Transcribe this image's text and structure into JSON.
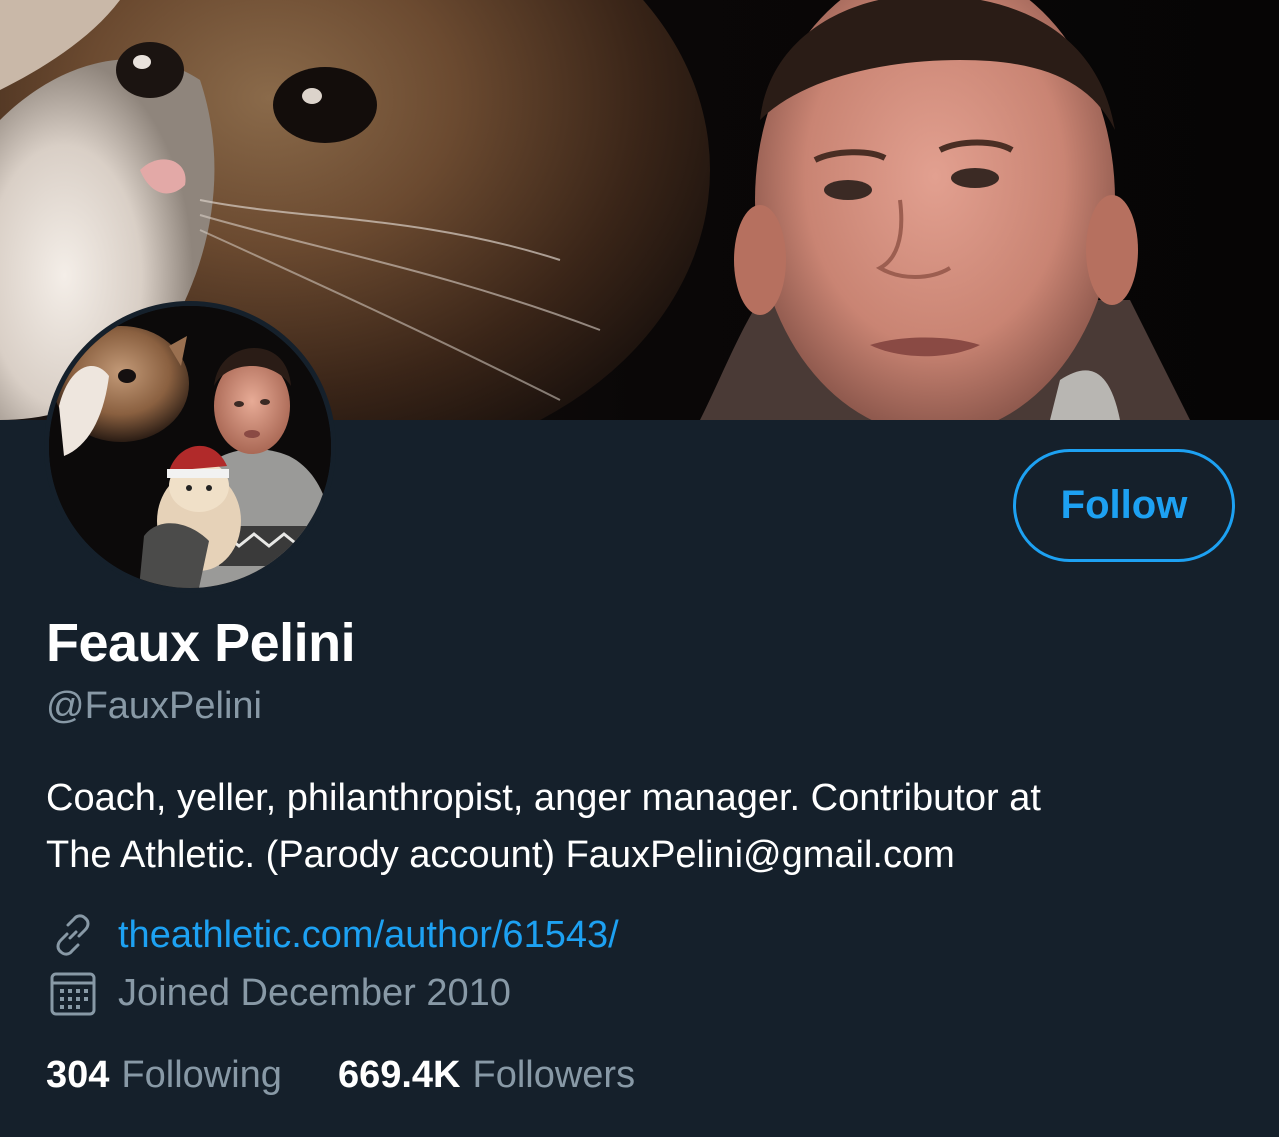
{
  "profile": {
    "display_name": "Feaux Pelini",
    "handle": "@FauxPelini",
    "bio_lines": [
      "Coach, yeller, philanthropist, anger manager. Contributor at",
      "The Athletic. (Parody account) FauxPelini@gmail.com"
    ],
    "website": "theathletic.com/author/61543/",
    "joined": "Joined December 2010",
    "following_count": "304",
    "following_label": "Following",
    "followers_count": "669.4K",
    "followers_label": "Followers"
  },
  "actions": {
    "follow_label": "Follow"
  },
  "icons": {
    "website": "link-icon",
    "joined": "calendar-icon"
  },
  "colors": {
    "background": "#15202b",
    "accent": "#1da1f2",
    "secondary_text": "#8899a6",
    "primary_text": "#ffffff"
  }
}
